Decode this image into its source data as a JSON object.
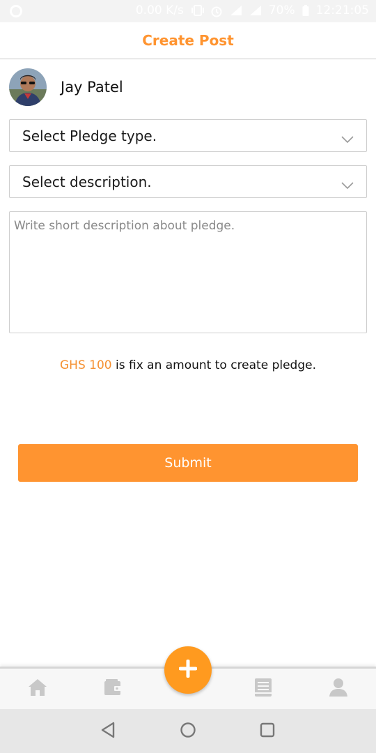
{
  "status_bar": {
    "net_speed": "0.00 K/s",
    "battery": "70%",
    "time": "12:21:05"
  },
  "header": {
    "title": "Create Post"
  },
  "user": {
    "name": "Jay Patel"
  },
  "form": {
    "pledge_type_select": {
      "value": "Select Pledge type."
    },
    "description_select": {
      "value": "Select description."
    },
    "short_description": {
      "placeholder": "Write short description about pledge.",
      "value": ""
    },
    "fee_amount": "GHS 100",
    "fee_text": " is fix an amount to create pledge.",
    "submit_label": "Submit"
  },
  "bottom_nav": {
    "items": [
      "home-icon",
      "wallet-icon",
      "add-icon",
      "book-icon",
      "profile-icon"
    ]
  },
  "colors": {
    "accent": "#ff9430",
    "fab": "#ff9a1f",
    "nav_icon": "#c8c8c8"
  }
}
